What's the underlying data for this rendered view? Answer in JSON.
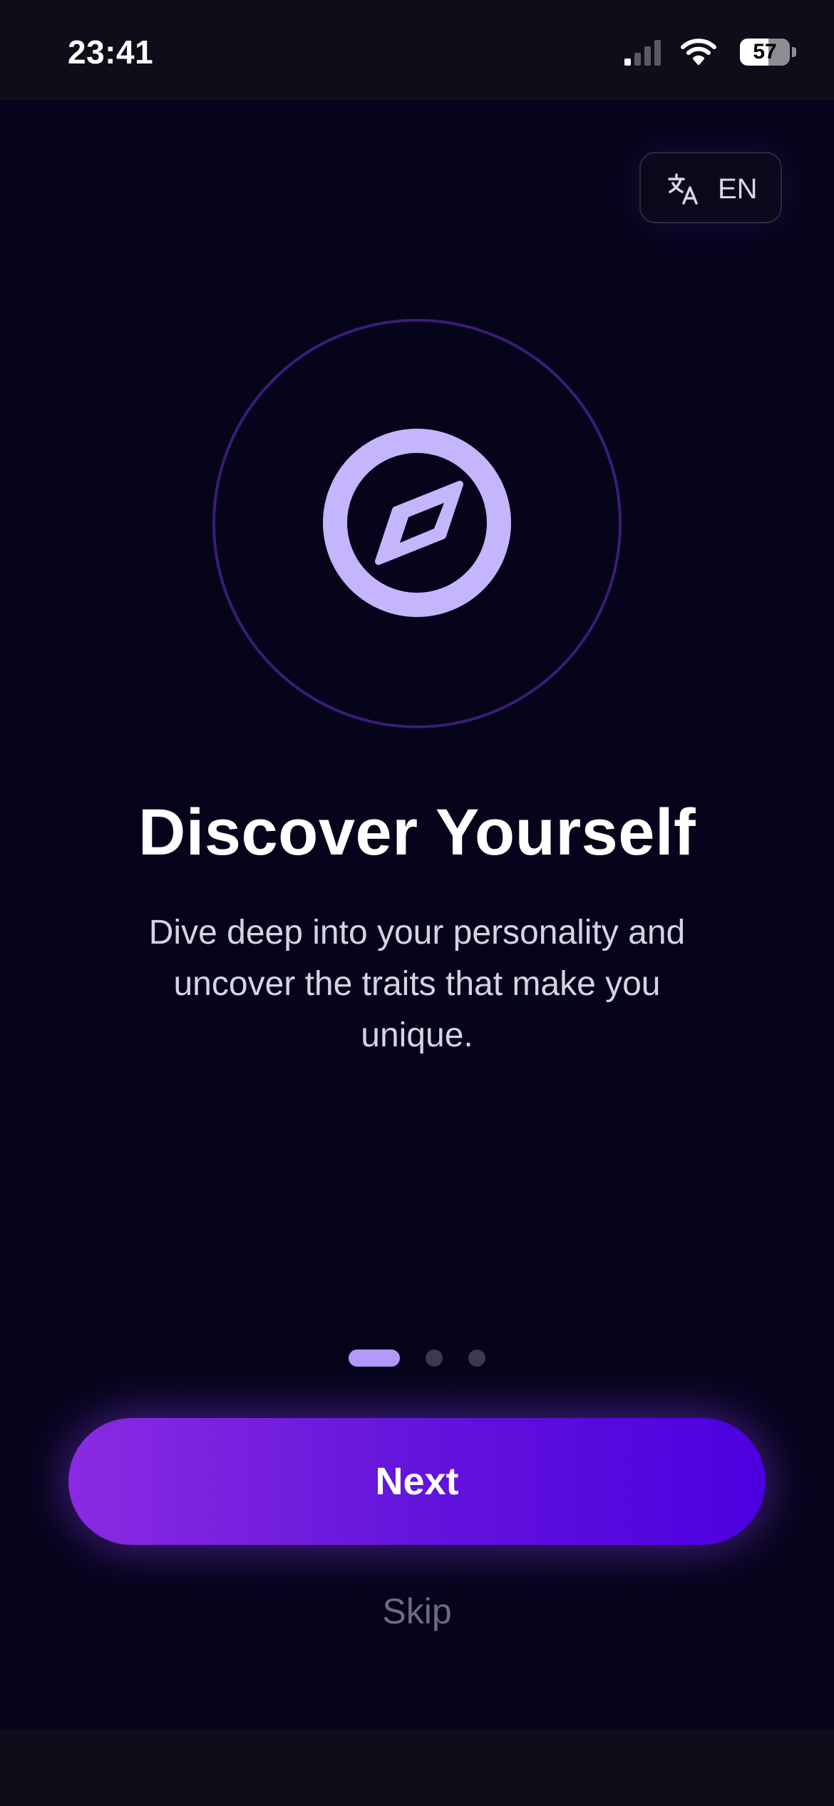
{
  "status_bar": {
    "time": "23:41",
    "battery": "57",
    "battery_level": 0.57
  },
  "language": {
    "icon": "translate-icon",
    "label": "EN"
  },
  "hero": {
    "icon": "compass-icon",
    "accent": "#c4b5fd",
    "ring_color": "#3a1c78"
  },
  "title": "Discover Yourself",
  "subtitle_lines": [
    "Dive deep into your personality and",
    "uncover the traits that make you",
    "unique."
  ],
  "pager": {
    "total": 3,
    "current": 1
  },
  "actions": {
    "next_label": "Next",
    "skip_label": "Skip"
  },
  "colors": {
    "background": "#06041a",
    "button_gradient_start": "#8a2be2",
    "button_gradient_end": "#4c00e0",
    "active_dot": "#b09bfb"
  }
}
